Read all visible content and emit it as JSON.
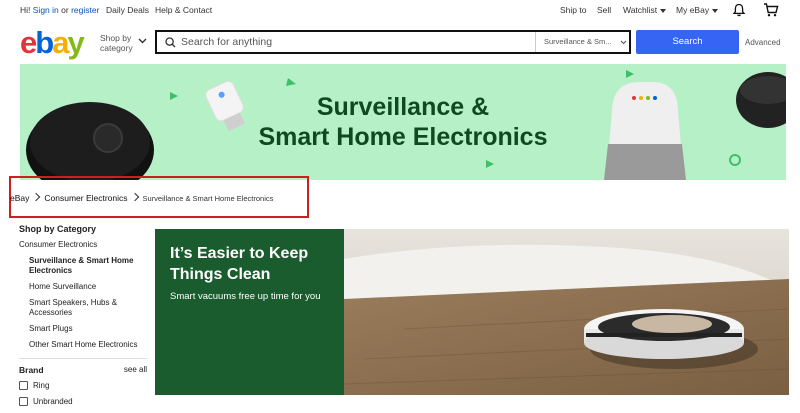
{
  "topbar": {
    "greeting": "Hi!",
    "sign_in": "Sign in",
    "or": "or",
    "register": "register",
    "daily_deals": "Daily Deals",
    "help_contact": "Help & Contact",
    "ship_to": "Ship to",
    "sell": "Sell",
    "watchlist": "Watchlist",
    "my_ebay": "My eBay",
    "bell_icon": "bell-icon",
    "cart_icon": "cart-icon"
  },
  "header": {
    "logo_letters": [
      "e",
      "b",
      "a",
      "y"
    ],
    "logo_colors": [
      "#e53238",
      "#0064d2",
      "#f5af02",
      "#86b817"
    ],
    "shop_by_line1": "Shop by",
    "shop_by_line2": "category",
    "search_placeholder": "Search for anything",
    "category_select": "Surveillance & Sm...",
    "search_button": "Search",
    "advanced": "Advanced"
  },
  "banner": {
    "line1": "Surveillance &",
    "line2": "Smart Home Electronics"
  },
  "breadcrumb": [
    "eBay",
    "Consumer Electronics",
    "Surveillance & Smart Home Electronics"
  ],
  "sidebar": {
    "title": "Shop by Category",
    "parent": "Consumer Electronics",
    "current": "Surveillance & Smart Home Electronics",
    "items": [
      "Home Surveillance",
      "Smart Speakers, Hubs & Accessories",
      "Smart Plugs",
      "Other Smart Home Electronics"
    ],
    "brand_title": "Brand",
    "see_all": "see all",
    "brands": [
      "Ring",
      "Unbranded"
    ]
  },
  "hero": {
    "title": "It’s Easier to Keep Things Clean",
    "subtitle": "Smart vacuums free up time for you"
  },
  "colors": {
    "search_button": "#3665f3",
    "banner_bg": "#b6f0c7",
    "banner_text": "#0f4a1f",
    "hero_green": "#1a5c2e",
    "highlight_box": "#cc1f1f"
  }
}
